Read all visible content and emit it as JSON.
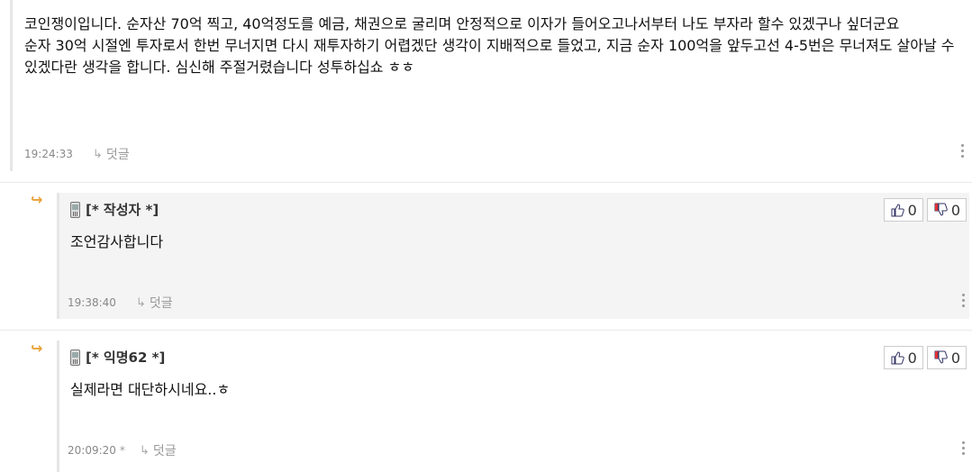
{
  "comment": {
    "lines": [
      "코인쟁이입니다. 순자산 70억 찍고, 40억정도를 예금, 채권으로 굴리며 안정적으로 이자가 들어오고나서부터 나도 부자라 할수 있겠구나 싶더군요",
      "순자 30억 시절엔 투자로서 한번 무너지면 다시 재투자하기 어렵겠단 생각이 지배적으로 들었고, 지금 순자 100억을 앞두고선 4-5번은 무너져도 살아날 수 있겠다란 생각을 합니다. 심신해 주절거렸습니다 성투하십쇼 ㅎㅎ"
    ],
    "time": "19:24:33",
    "reply_label": "덧글"
  },
  "replies": [
    {
      "author": "[* 작성자 *]",
      "text": "조언감사합니다",
      "time": "19:38:40",
      "time_suffix": "",
      "reply_label": "덧글",
      "likes": "0",
      "dislikes": "0"
    },
    {
      "author": "[* 익명62 *]",
      "text": "실제라면 대단하시네요..ㅎ",
      "time": "20:09:20",
      "time_suffix": "*",
      "reply_label": "덧글",
      "likes": "0",
      "dislikes": "0"
    }
  ],
  "icons": {
    "reply_arrow": "reply-arrow-icon",
    "phone": "mobile-phone-icon",
    "like": "thumbs-up-icon",
    "dislike": "thumbs-down-icon",
    "more": "kebab-menu-icon"
  },
  "colors": {
    "reply_arrow": "#e8a23a",
    "dislike_accent": "#d33"
  }
}
